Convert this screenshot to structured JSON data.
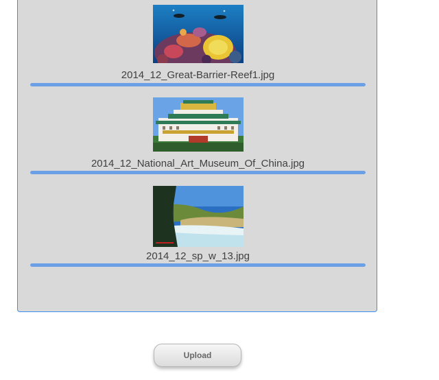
{
  "files": [
    {
      "name": "2014_12_Great-Barrier-Reef1.jpg",
      "thumbnail": "coral-reef-divers-photo",
      "progress": 1.0
    },
    {
      "name": "2014_12_National_Art_Museum_Of_China.jpg",
      "thumbnail": "museum-building-photo",
      "progress": 1.0
    },
    {
      "name": "2014_12_sp_w_13.jpg",
      "thumbnail": "forest-river-landscape-photo",
      "progress": 1.0
    }
  ],
  "upload_button": {
    "label": "Upload"
  },
  "colors": {
    "dropzone_bg": "#d9d9d9",
    "dropzone_border": "#3d8ee8",
    "progress_fill": "#6b9fe6",
    "file_name_text": "#404040"
  }
}
